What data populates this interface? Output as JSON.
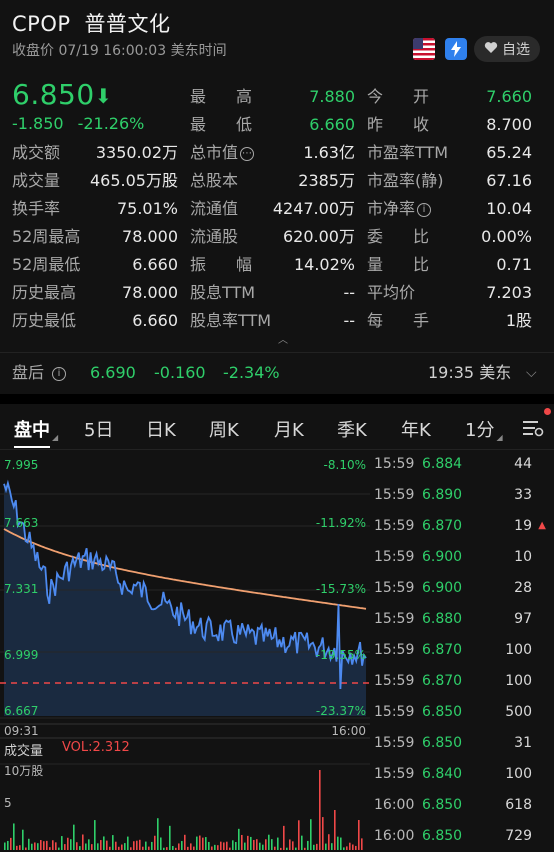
{
  "header": {
    "symbol": "CPOP",
    "name": "普普文化",
    "status": "收盘价 07/19 16:00:03 美东时间",
    "watch_label": "自选"
  },
  "quote": {
    "price": "6.850",
    "change": "-1.850",
    "change_pct": "-21.26%",
    "rows": [
      [
        {
          "label": "最　高",
          "value": "7.880",
          "tone": "green"
        },
        {
          "label": "今　开",
          "value": "7.660",
          "tone": "green"
        }
      ],
      [
        {
          "label": "最　低",
          "value": "6.660",
          "tone": "green"
        },
        {
          "label": "昨　收",
          "value": "8.700",
          "tone": ""
        }
      ],
      [
        {
          "label": "成交额",
          "value": "3350.02万"
        },
        {
          "label": "总市值",
          "value": "1.63亿",
          "info": true
        },
        {
          "label": "市盈率TTM",
          "value": "65.24"
        }
      ],
      [
        {
          "label": "成交量",
          "value": "465.05万股"
        },
        {
          "label": "总股本",
          "value": "2385万"
        },
        {
          "label": "市盈率(静)",
          "value": "67.16"
        }
      ],
      [
        {
          "label": "换手率",
          "value": "75.01%"
        },
        {
          "label": "流通值",
          "value": "4247.00万"
        },
        {
          "label": "市净率",
          "value": "10.04",
          "info": true
        }
      ],
      [
        {
          "label": "52周最高",
          "value": "78.000"
        },
        {
          "label": "流通股",
          "value": "620.00万"
        },
        {
          "label": "委　比",
          "value": "0.00%"
        }
      ],
      [
        {
          "label": "52周最低",
          "value": "6.660"
        },
        {
          "label": "振　幅",
          "value": "14.02%"
        },
        {
          "label": "量　比",
          "value": "0.71"
        }
      ],
      [
        {
          "label": "历史最高",
          "value": "78.000"
        },
        {
          "label": "股息TTM",
          "value": "--"
        },
        {
          "label": "平均价",
          "value": "7.203"
        }
      ],
      [
        {
          "label": "历史最低",
          "value": "6.660"
        },
        {
          "label": "股息率TTM",
          "value": "--"
        },
        {
          "label": "每　手",
          "value": "1股"
        }
      ]
    ]
  },
  "after_hours": {
    "label": "盘后",
    "price": "6.690",
    "change": "-0.160",
    "change_pct": "-2.34%",
    "time": "19:35 美东"
  },
  "tabs": [
    "盘中",
    "5日",
    "日K",
    "周K",
    "月K",
    "季K",
    "年K",
    "1分"
  ],
  "chart": {
    "y_labels_left": [
      "7.995",
      "7.663",
      "7.331",
      "6.999",
      "6.667"
    ],
    "y_labels_right": [
      "-8.10%",
      "-11.92%",
      "-15.73%",
      "-19.55%",
      "-23.37%"
    ],
    "x_start": "09:31",
    "x_end": "16:00",
    "volume_label": "成交量",
    "vol_value": "VOL:2.312",
    "vol_unit": "10万股",
    "vol_tick": "5",
    "colors": {
      "price": "#4d8af0",
      "avg": "#f0a070",
      "ref": "#f04848",
      "fill": "#1a2a40"
    }
  },
  "ticks": [
    {
      "time": "15:59",
      "price": "6.884",
      "vol": "44",
      "flag": ""
    },
    {
      "time": "15:59",
      "price": "6.890",
      "vol": "33",
      "flag": ""
    },
    {
      "time": "15:59",
      "price": "6.870",
      "vol": "19",
      "flag": "up"
    },
    {
      "time": "15:59",
      "price": "6.900",
      "vol": "10",
      "flag": ""
    },
    {
      "time": "15:59",
      "price": "6.900",
      "vol": "28",
      "flag": ""
    },
    {
      "time": "15:59",
      "price": "6.880",
      "vol": "97",
      "flag": ""
    },
    {
      "time": "15:59",
      "price": "6.870",
      "vol": "100",
      "flag": ""
    },
    {
      "time": "15:59",
      "price": "6.870",
      "vol": "100",
      "flag": ""
    },
    {
      "time": "15:59",
      "price": "6.850",
      "vol": "500",
      "flag": ""
    },
    {
      "time": "15:59",
      "price": "6.850",
      "vol": "31",
      "flag": ""
    },
    {
      "time": "15:59",
      "price": "6.840",
      "vol": "100",
      "flag": ""
    },
    {
      "time": "16:00",
      "price": "6.850",
      "vol": "618",
      "flag": ""
    },
    {
      "time": "16:00",
      "price": "6.850",
      "vol": "729",
      "flag": ""
    }
  ]
}
